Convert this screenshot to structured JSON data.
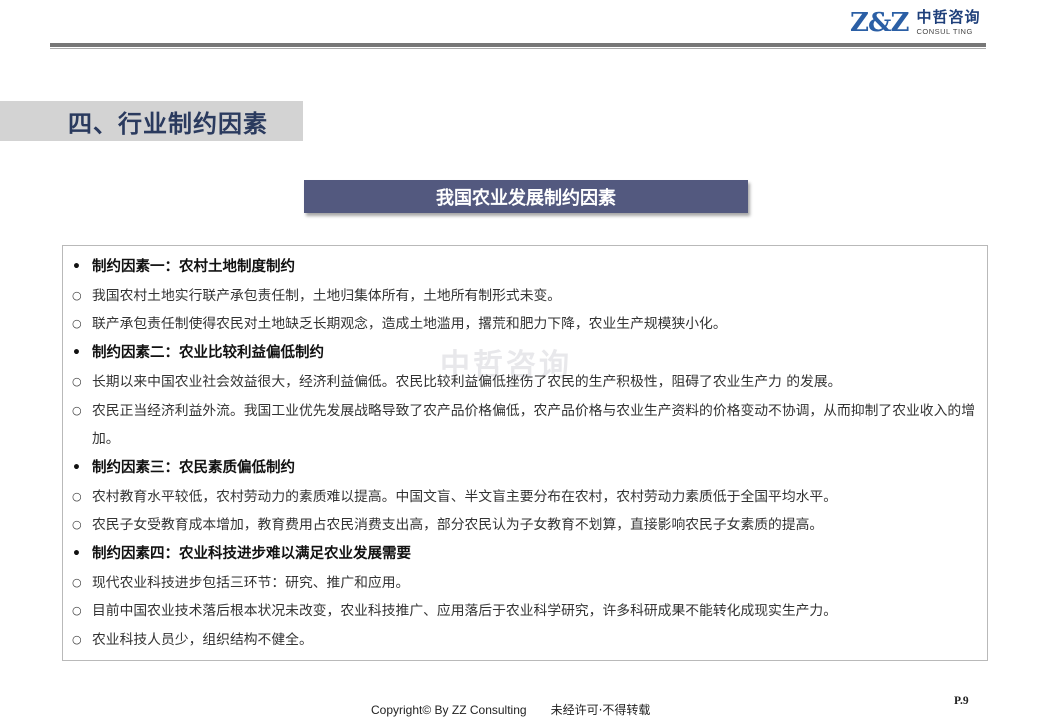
{
  "header": {
    "logo_mark": "Z&Z",
    "logo_cn": "中哲咨询",
    "logo_en": "CONSUL TING"
  },
  "section_title": "四、行业制约因素",
  "banner_title": "我国农业发展制约因素",
  "watermark": "中哲咨询",
  "items": [
    {
      "type": "heading",
      "marker": "•",
      "text": "制约因素一：农村土地制度制约"
    },
    {
      "type": "sub",
      "marker": "○",
      "text": "我国农村土地实行联产承包责任制，土地归集体所有，土地所有制形式未变。"
    },
    {
      "type": "sub",
      "marker": "○",
      "text": "联产承包责任制使得农民对土地缺乏长期观念，造成土地滥用，撂荒和肥力下降，农业生产规模狭小化。"
    },
    {
      "type": "heading",
      "marker": "•",
      "text": "制约因素二：农业比较利益偏低制约"
    },
    {
      "type": "sub",
      "marker": "○",
      "text": "长期以来中国农业社会效益很大，经济利益偏低。农民比较利益偏低挫伤了农民的生产积极性，阻碍了农业生产力 的发展。"
    },
    {
      "type": "sub",
      "marker": "○",
      "text": "农民正当经济利益外流。我国工业优先发展战略导致了农产品价格偏低，农产品价格与农业生产资料的价格变动不协调，从而抑制了农业收入的增加。"
    },
    {
      "type": "heading",
      "marker": "•",
      "text": "制约因素三：农民素质偏低制约"
    },
    {
      "type": "sub",
      "marker": "○",
      "text": "农村教育水平较低，农村劳动力的素质难以提高。中国文盲、半文盲主要分布在农村，农村劳动力素质低于全国平均水平。"
    },
    {
      "type": "sub",
      "marker": "○",
      "text": "农民子女受教育成本增加，教育费用占农民消费支出高，部分农民认为子女教育不划算，直接影响农民子女素质的提高。"
    },
    {
      "type": "heading",
      "marker": "•",
      "text": "制约因素四：农业科技进步难以满足农业发展需要"
    },
    {
      "type": "sub",
      "marker": "○",
      "text": "现代农业科技进步包括三环节：研究、推广和应用。"
    },
    {
      "type": "sub",
      "marker": "○",
      "text": "目前中国农业技术落后根本状况未改变，农业科技推广、应用落后于农业科学研究，许多科研成果不能转化成现实生产力。"
    },
    {
      "type": "sub",
      "marker": "○",
      "text": "农业科技人员少，组织结构不健全。"
    }
  ],
  "footer": {
    "copyright": "Copyright© By  ZZ Consulting",
    "note": "未经许可·不得转载"
  },
  "page_number": "P.9",
  "colors": {
    "banner_bg": "#53597f",
    "section_bg": "#d3d3d3",
    "section_text": "#2a3a5e",
    "logo_blue": "#2b5fa5"
  }
}
